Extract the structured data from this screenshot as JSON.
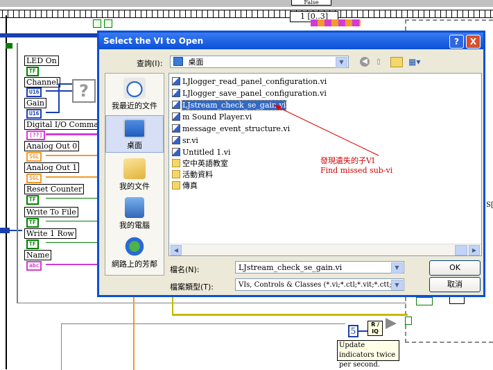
{
  "diagram": {
    "top_case": "1 [0..3]",
    "false_case": "False",
    "controls": [
      {
        "label": "LED On",
        "type": "TF"
      },
      {
        "label": "Channel",
        "type": "U16"
      },
      {
        "label": "Gain",
        "type": "U16"
      },
      {
        "label": "Digital I/O Commands",
        "type": "[??]"
      },
      {
        "label": "Analog Out 0",
        "type": "SGL"
      },
      {
        "label": "Analog Out 1",
        "type": "SGL"
      },
      {
        "label": "Reset Counter",
        "type": "TF"
      },
      {
        "label": "Write To File",
        "type": "TF"
      },
      {
        "label": "Write 1 Row",
        "type": "TF"
      },
      {
        "label": "Name",
        "type": "abc"
      }
    ],
    "missing_subvi": "?",
    "constant_value": "5",
    "ratio_node": "R / IQ",
    "comment": "Update indicators twice per second.",
    "right_label": "S["
  },
  "dialog": {
    "title": "Select the VI to Open",
    "help_btn": "?",
    "close_btn": "X",
    "look_in_label": "查詢(I):",
    "look_in_value": "桌面",
    "places": [
      "我最近的文件",
      "桌面",
      "我的文件",
      "我的電腦",
      "網路上的芳鄰"
    ],
    "files": [
      {
        "name": "LJlogger_read_panel_configuration.vi",
        "kind": "vi"
      },
      {
        "name": "LJlogger_save_panel_configuration.vi",
        "kind": "vi"
      },
      {
        "name": "LJstream_check_se_gain.vi",
        "kind": "vi",
        "selected": true
      },
      {
        "name": "m Sound Player.vi",
        "kind": "vi"
      },
      {
        "name": "message_event_structure.vi",
        "kind": "vi"
      },
      {
        "name": "sr.vi",
        "kind": "vi"
      },
      {
        "name": "Untitled 1.vi",
        "kind": "vi"
      },
      {
        "name": "空中英語教室",
        "kind": "folder"
      },
      {
        "name": "活動資料",
        "kind": "folder"
      },
      {
        "name": "傳真",
        "kind": "folder"
      }
    ],
    "annotation_zh": "發現遺失的子VI",
    "annotation_en": "Find missed sub-vi",
    "filename_label": "檔名(N):",
    "filename_value": "LJstream_check_se_gain.vi",
    "filetype_label": "檔案類型(T):",
    "filetype_value": "VIs, Controls & Classes (*.vi;*.ctl;*.vit;*.ctt;*.l",
    "ok_label": "OK",
    "cancel_label": "取消"
  }
}
